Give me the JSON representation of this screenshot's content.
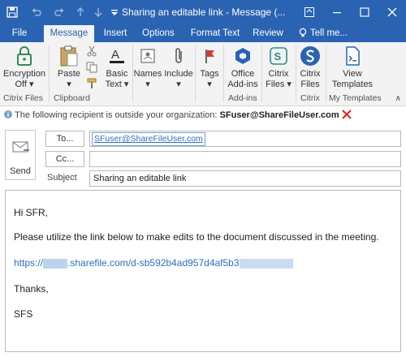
{
  "titlebar": {
    "title": "Sharing an editable link - Message (..."
  },
  "tabs": [
    "File",
    "Message",
    "Insert",
    "Options",
    "Format Text",
    "Review",
    "Tell me..."
  ],
  "ribbon": {
    "encryption": [
      "Encryption",
      "Off"
    ],
    "paste": "Paste",
    "basic_text": [
      "Basic",
      "Text"
    ],
    "names": "Names",
    "include": "Include",
    "tags": "Tags",
    "office_addins": [
      "Office",
      "Add-ins"
    ],
    "citrix_files_dd": [
      "Citrix",
      "Files"
    ],
    "citrix_files": [
      "Citrix",
      "Files"
    ],
    "view_templates": [
      "View",
      "Templates"
    ],
    "groups": [
      "Citrix Files",
      "Clipboard",
      "Add-ins",
      "Citrix",
      "My Templates"
    ]
  },
  "infobar": {
    "text": "The following recipient is outside your organization:",
    "address": "SFuser@ShareFileUser.com"
  },
  "compose": {
    "send": "Send",
    "to_label": "To...",
    "cc_label": "Cc...",
    "subject_label": "Subject",
    "to_value": "SFuser@ShareFileUser.com",
    "cc_value": "",
    "subject_value": "Sharing an editable link"
  },
  "body": {
    "greeting": "Hi SFR,",
    "line1": "Please utilize the link below to make edits to the document discussed in the meeting.",
    "link_start": "https://",
    "link_end": ".sharefile.com/d-sb592b4ad957d4af5b3",
    "thanks": "Thanks,",
    "signature": "SFS"
  },
  "colors": {
    "accent": "#2b63b3",
    "ribbon_bg": "#f3f3f3",
    "link": "#2f6fbd",
    "warning": "#e02020"
  }
}
